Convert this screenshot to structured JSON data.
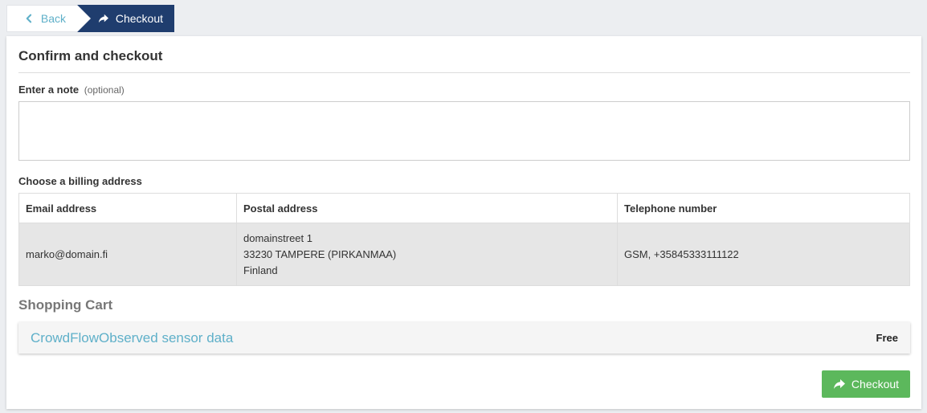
{
  "nav": {
    "back_label": "Back",
    "current_label": "Checkout"
  },
  "page": {
    "title": "Confirm and checkout"
  },
  "note": {
    "label": "Enter a note",
    "optional_hint": "(optional)",
    "value": ""
  },
  "billing": {
    "label": "Choose a billing address",
    "headers": [
      "Email address",
      "Postal address",
      "Telephone number"
    ],
    "row": {
      "email": "marko@domain.fi",
      "postal_line1": "domainstreet 1",
      "postal_line2": "33230 TAMPERE (PIRKANMAA)",
      "postal_line3": "Finland",
      "phone": "GSM, +35845333111122"
    }
  },
  "cart": {
    "title": "Shopping Cart",
    "items": [
      {
        "name": "CrowdFlowObserved sensor data",
        "price": "Free"
      }
    ]
  },
  "actions": {
    "checkout_label": "Checkout"
  },
  "colors": {
    "accent": "#5fb0c9",
    "nav_active": "#1f3d6e",
    "success": "#5cb85c"
  }
}
